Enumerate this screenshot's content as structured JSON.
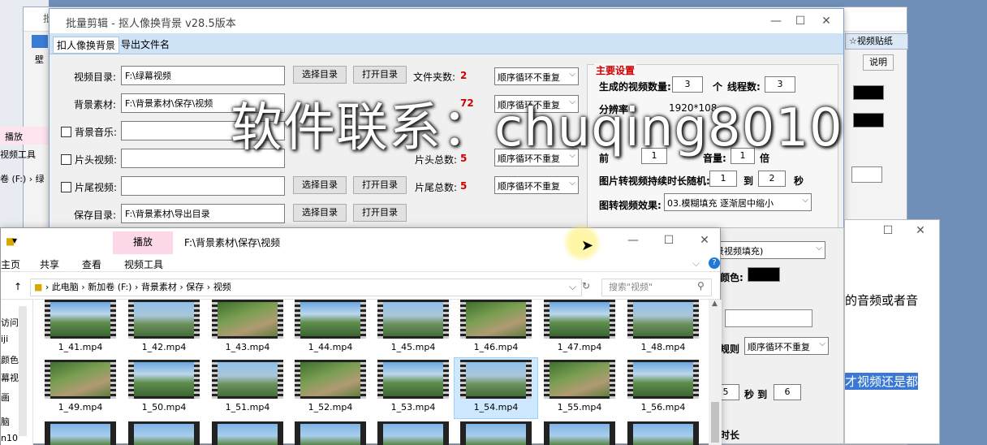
{
  "bg_window": {
    "title_left": "批",
    "left_tabs": [
      "壁"
    ],
    "play_tab": "播放",
    "video_tools": "视频工具",
    "drive_text": "卷 (F:) › 绿",
    "right_tab": "视频贴纸",
    "right_button": "说明"
  },
  "app": {
    "title": "批量剪辑 - 抠人像换背景   v28.5版本",
    "min": "—",
    "max": "☐",
    "close": "✕",
    "tabs": [
      "扣人像换背景",
      "导出文件名"
    ],
    "rows": [
      {
        "label": "视频目录:",
        "value": "F:\\绿幕视频",
        "checkbox": false,
        "btn1": "选择目录",
        "btn2": "打开目录",
        "count_label": "文件夹数:",
        "count": "2",
        "mode": "顺序循环不重复"
      },
      {
        "label": "背景素材:",
        "value": "F:\\背景素材\\保存\\视频",
        "checkbox": false,
        "btn1": "选择目录",
        "btn2": "打开目录",
        "count_label": "",
        "count": "72",
        "mode": "顺序循环不重复"
      },
      {
        "label": "背景音乐:",
        "value": "",
        "checkbox": true,
        "btn1": "选择目录",
        "btn2": "打开目录",
        "count_label": "",
        "count": "",
        "mode": ""
      },
      {
        "label": "片头视频:",
        "value": "",
        "checkbox": true,
        "btn1": "选择目录",
        "btn2": "打开目录",
        "count_label": "片头总数:",
        "count": "5",
        "mode": "顺序循环不重复"
      },
      {
        "label": "片尾视频:",
        "value": "",
        "checkbox": true,
        "btn1": "选择目录",
        "btn2": "打开目录",
        "count_label": "片尾总数:",
        "count": "5",
        "mode": "顺序循环不重复"
      },
      {
        "label": "保存目录:",
        "value": "F:\\背景素材\\导出目录",
        "checkbox": false,
        "btn1": "选择目录",
        "btn2": "打开目录",
        "count_label": "",
        "count": "",
        "mode": ""
      }
    ],
    "settings": {
      "title": "主要设置",
      "gen_label": "生成的视频数量:",
      "gen_value": "3",
      "gen_unit": "个",
      "threads_label": "线程数:",
      "threads_value": "3",
      "res_label": "分辨率",
      "res_value": "1920*108",
      "front_label": "前",
      "front_value": "1",
      "vol_label": "音量:",
      "vol_value": "1",
      "vol_unit": "倍",
      "img_dur_label": "图片转视频持续时长随机:",
      "img_dur_from": "1",
      "img_dur_to_label": "到",
      "img_dur_to": "2",
      "img_dur_unit": "秒",
      "img_effect_label": "图转视频效果:",
      "img_effect_value": "03.模糊填充 逐渐居中缩小"
    }
  },
  "mid_panel": {
    "fill_select": "景视频填充)",
    "color_label": "颜色:",
    "rule_label": "规则",
    "rule_value": "顺序循环不重复",
    "sec_from": "5",
    "sec_label": "秒 到",
    "sec_to": "6",
    "dur_label": "时长"
  },
  "right_panel": {
    "text1": "的音频或者音",
    "text2": "才视频还是都"
  },
  "explorer": {
    "play_tab": "播放",
    "path_title": "F:\\背景素材\\保存\\视频",
    "ribbon": [
      "主页",
      "共享",
      "查看",
      "视频工具"
    ],
    "breadcrumb": [
      "此电脑",
      "新加卷 (F:)",
      "背景素材",
      "保存",
      "视频"
    ],
    "search_placeholder": "搜索\"视频\"",
    "nav": [
      "访问",
      "iji",
      "颜色",
      "幕视",
      "画",
      "",
      "脑",
      "n10"
    ],
    "files_row1": [
      "1_41.mp4",
      "1_42.mp4",
      "1_43.mp4",
      "1_44.mp4",
      "1_45.mp4",
      "1_46.mp4",
      "1_47.mp4",
      "1_48.mp4"
    ],
    "files_row2": [
      "1_49.mp4",
      "1_50.mp4",
      "1_51.mp4",
      "1_52.mp4",
      "1_53.mp4",
      "1_54.mp4",
      "1_55.mp4",
      "1_56.mp4"
    ],
    "selected_file": "1_54.mp4"
  },
  "watermark": "软件联系：chuqing8010"
}
